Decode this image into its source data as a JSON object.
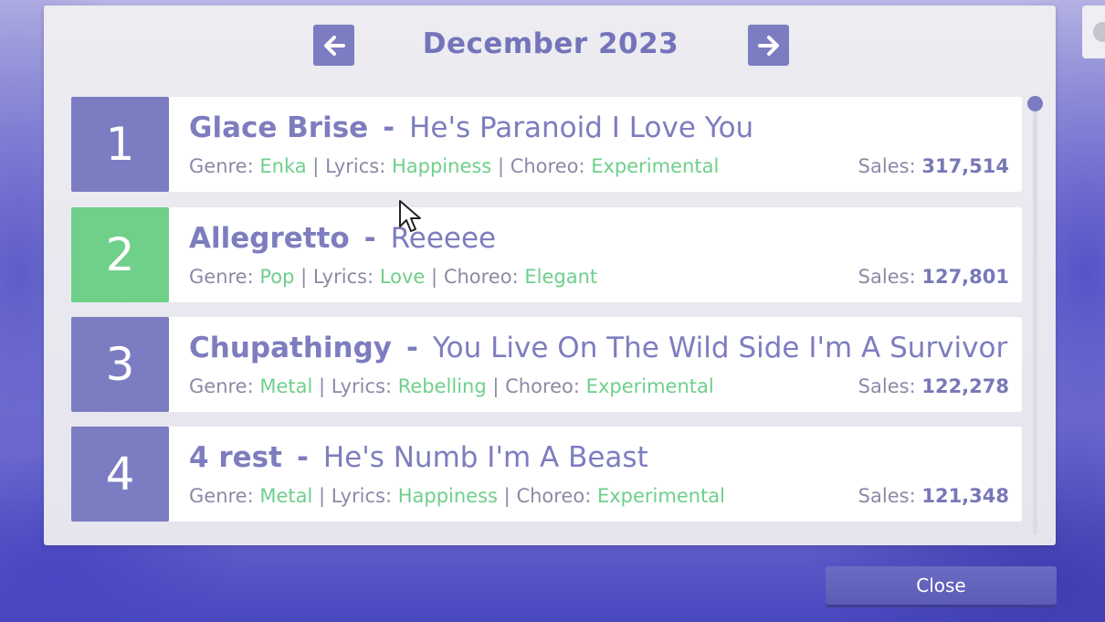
{
  "header": {
    "month_title": "December 2023",
    "prev_icon": "arrow-left-icon",
    "next_icon": "arrow-right-icon"
  },
  "meta_labels": {
    "genre": "Genre:",
    "lyrics": "Lyrics:",
    "choreo": "Choreo:",
    "sales": "Sales:",
    "separator": "|",
    "dash": "-"
  },
  "entries": [
    {
      "rank": "1",
      "artist": "Glace Brise",
      "title": "He's Paranoid I Love You",
      "genre": "Enka",
      "lyrics": "Happiness",
      "choreo": "Experimental",
      "sales": "317,514",
      "rank_color": "#7b7cc2"
    },
    {
      "rank": "2",
      "artist": "Allegretto",
      "title": "Reeeee",
      "genre": "Pop",
      "lyrics": "Love",
      "choreo": "Elegant",
      "sales": "127,801",
      "rank_color": "#6fd089"
    },
    {
      "rank": "3",
      "artist": "Chupathingy",
      "title": "You Live On The Wild Side I'm A Survivor",
      "genre": "Metal",
      "lyrics": "Rebelling",
      "choreo": "Experimental",
      "sales": "122,278",
      "rank_color": "#7b7cc2"
    },
    {
      "rank": "4",
      "artist": "4 rest",
      "title": "He's Numb I'm A Beast",
      "genre": "Metal",
      "lyrics": "Happiness",
      "choreo": "Experimental",
      "sales": "121,348",
      "rank_color": "#7b7cc2"
    }
  ],
  "footer": {
    "close_label": "Close"
  },
  "colors": {
    "accent_purple": "#7b7cc2",
    "highlight_green": "#6fd089",
    "value_green": "#6fcf8b"
  }
}
